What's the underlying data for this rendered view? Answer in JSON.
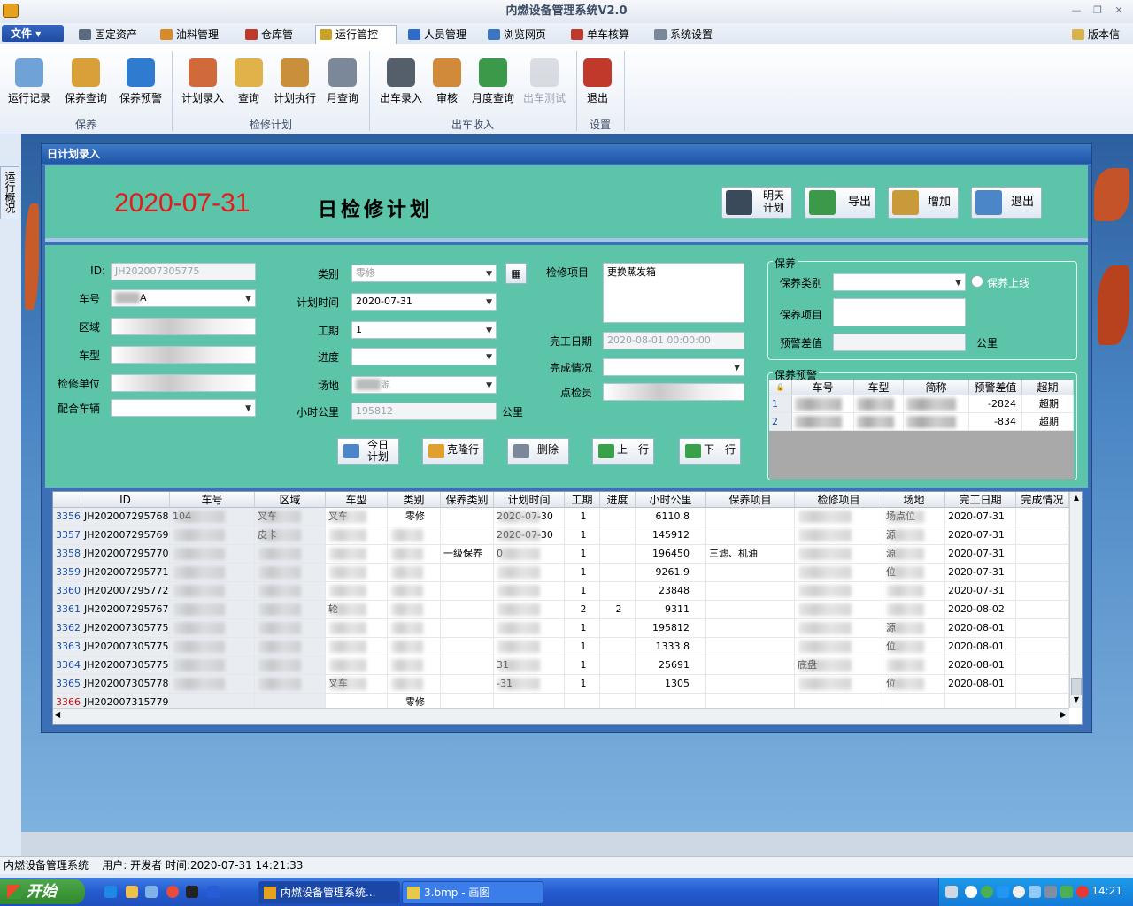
{
  "window": {
    "title": "内燃设备管理系统V2.0"
  },
  "menu": {
    "file": "文件",
    "items": [
      {
        "label": "固定资产",
        "color": "#5a6b80"
      },
      {
        "label": "油料管理",
        "color": "#d88a2a"
      },
      {
        "label": "仓库管理",
        "color": "#c0392b"
      },
      {
        "label": "运行管控",
        "color": "#c9a12a"
      },
      {
        "label": "人员管理",
        "color": "#2f6cc7"
      },
      {
        "label": "浏览网页",
        "color": "#3a76c4"
      },
      {
        "label": "单车核算",
        "color": "#c0392b"
      },
      {
        "label": "系统设置",
        "color": "#7a8899"
      }
    ],
    "version": "版本信息"
  },
  "ribbon": {
    "buttons": [
      {
        "label": "运行记录",
        "color": "#6fa3d8"
      },
      {
        "label": "保养查询",
        "color": "#d9a03a"
      },
      {
        "label": "保养预警",
        "color": "#2f7bd0"
      },
      {
        "label": "计划录入",
        "color": "#d06a3a"
      },
      {
        "label": "查询",
        "color": "#e0b24a"
      },
      {
        "label": "计划执行",
        "color": "#c98f3a"
      },
      {
        "label": "月查询",
        "color": "#7a8899"
      },
      {
        "label": "出车录入",
        "color": "#555f6b"
      },
      {
        "label": "审核",
        "color": "#d08a3a"
      },
      {
        "label": "月度查询",
        "color": "#3a9a4a"
      },
      {
        "label": "出车测试",
        "color": "#a9b1bb"
      },
      {
        "label": "退出",
        "color": "#c0392b"
      }
    ],
    "groups": [
      "保养",
      "检修计划",
      "出车收入",
      "设置"
    ]
  },
  "sidetab": "运行概况",
  "dialog": {
    "title": "日计划录入",
    "date": "2020-07-31",
    "heading": "日检修计划",
    "header_buttons": [
      "明天\n计划",
      "导出",
      "增加",
      "退出"
    ],
    "form": {
      "id_label": "ID:",
      "id_value": "JH202007305775",
      "car_label": "车号",
      "car_value": "A",
      "area_label": "区域",
      "model_label": "车型",
      "unit_label": "检修单位",
      "partner_label": "配合车辆",
      "type_label": "类别",
      "type_value": "零修",
      "plan_time_label": "计划时间",
      "plan_time_value": "2020-07-31",
      "days_label": "工期",
      "days_value": "1",
      "progress_label": "进度",
      "site_label": "场地",
      "site_value": "源",
      "hours_label": "小时公里",
      "hours_value": "195812",
      "hours_unit": "公里",
      "item_label": "检修项目",
      "item_value": "更换蒸发箱",
      "finish_label": "完工日期",
      "finish_value": "2020-08-01 00:00:00",
      "complete_label": "完成情况",
      "inspector_label": "点检员"
    },
    "maint": {
      "legend": "保养",
      "type_label": "保养类别",
      "item_label": "保养项目",
      "warn_label": "预警差值",
      "unit": "公里",
      "online": "保养上线"
    },
    "warning": {
      "legend": "保养预警",
      "headers": [
        "车号",
        "车型",
        "简称",
        "预警差值",
        "超期"
      ],
      "rows": [
        {
          "n": "1",
          "diff": "-2824",
          "status": "超期"
        },
        {
          "n": "2",
          "diff": "-834",
          "status": "超期"
        }
      ]
    },
    "actions": [
      "今日\n计划",
      "克隆行",
      "删除",
      "上一行",
      "下一行"
    ],
    "table": {
      "headers": [
        "ID",
        "车号",
        "区域",
        "车型",
        "类别",
        "保养类别",
        "计划时间",
        "工期",
        "进度",
        "小时公里",
        "保养项目",
        "检修项目",
        "场地",
        "完工日期",
        "完成情况"
      ],
      "rows": [
        {
          "n": "3356",
          "id": "JH202007295768",
          "car": "104",
          "area": "叉车",
          "model": "叉车",
          "type": "零修",
          "mtype": "",
          "time": "2020-07-30",
          "days": "1",
          "prog": "",
          "hours": "6110.8",
          "mitem": "",
          "item": "",
          "site": "场点位",
          "fin": "2020-07-31",
          "done": ""
        },
        {
          "n": "3357",
          "id": "JH202007295769",
          "car": "",
          "area": "皮卡",
          "model": "",
          "type": "",
          "mtype": "",
          "time": "2020-07-30",
          "days": "1",
          "prog": "",
          "hours": "145912",
          "mitem": "",
          "item": "",
          "site": "源",
          "fin": "2020-07-31",
          "done": ""
        },
        {
          "n": "3358",
          "id": "JH202007295770",
          "car": "",
          "area": "",
          "model": "",
          "type": "",
          "mtype": "一级保养",
          "time": "0",
          "days": "1",
          "prog": "",
          "hours": "196450",
          "mitem": "三滤、机油",
          "item": "",
          "site": "源",
          "fin": "2020-07-31",
          "done": ""
        },
        {
          "n": "3359",
          "id": "JH202007295771",
          "car": "",
          "area": "",
          "model": "",
          "type": "",
          "mtype": "",
          "time": "",
          "days": "1",
          "prog": "",
          "hours": "9261.9",
          "mitem": "",
          "item": "",
          "site": "位",
          "fin": "2020-07-31",
          "done": ""
        },
        {
          "n": "3360",
          "id": "JH202007295772",
          "car": "",
          "area": "",
          "model": "",
          "type": "",
          "mtype": "",
          "time": "",
          "days": "1",
          "prog": "",
          "hours": "23848",
          "mitem": "",
          "item": "",
          "site": "",
          "fin": "2020-07-31",
          "done": ""
        },
        {
          "n": "3361",
          "id": "JH202007295767",
          "car": "",
          "area": "",
          "model": "轮",
          "type": "",
          "mtype": "",
          "time": "",
          "days": "2",
          "prog": "2",
          "hours": "9311",
          "mitem": "",
          "item": "",
          "site": "",
          "fin": "2020-08-02",
          "done": ""
        },
        {
          "n": "3362",
          "id": "JH202007305775",
          "car": "",
          "area": "",
          "model": "",
          "type": "",
          "mtype": "",
          "time": "",
          "days": "1",
          "prog": "",
          "hours": "195812",
          "mitem": "",
          "item": "",
          "site": "源",
          "fin": "2020-08-01",
          "done": ""
        },
        {
          "n": "3363",
          "id": "JH202007305775",
          "car": "",
          "area": "",
          "model": "",
          "type": "",
          "mtype": "",
          "time": "",
          "days": "1",
          "prog": "",
          "hours": "1333.8",
          "mitem": "",
          "item": "",
          "site": "位",
          "fin": "2020-08-01",
          "done": ""
        },
        {
          "n": "3364",
          "id": "JH202007305775",
          "car": "",
          "area": "",
          "model": "",
          "type": "",
          "mtype": "",
          "time": "31",
          "days": "1",
          "prog": "",
          "hours": "25691",
          "mitem": "",
          "item": "底盘",
          "site": "",
          "fin": "2020-08-01",
          "done": ""
        },
        {
          "n": "3365",
          "id": "JH202007305778",
          "car": "",
          "area": "",
          "model": "叉车",
          "type": "",
          "mtype": "",
          "time": "-31",
          "days": "1",
          "prog": "",
          "hours": "1305",
          "mitem": "",
          "item": "",
          "site": "位",
          "fin": "2020-08-01",
          "done": ""
        },
        {
          "n": "3366",
          "id": "JH202007315779",
          "car": "",
          "area": "",
          "model": "",
          "type": "零修",
          "mtype": "",
          "time": "",
          "days": "",
          "prog": "",
          "hours": "",
          "mitem": "",
          "item": "",
          "site": "",
          "fin": "",
          "done": ""
        }
      ]
    }
  },
  "status": {
    "app": "内燃设备管理系统",
    "user": "用户: 开发者 时间:2020-07-31 14:21:33"
  },
  "taskbar": {
    "start": "开始",
    "tasks": [
      "内燃设备管理系统...",
      "3.bmp - 画图"
    ],
    "clock": "14:21"
  }
}
